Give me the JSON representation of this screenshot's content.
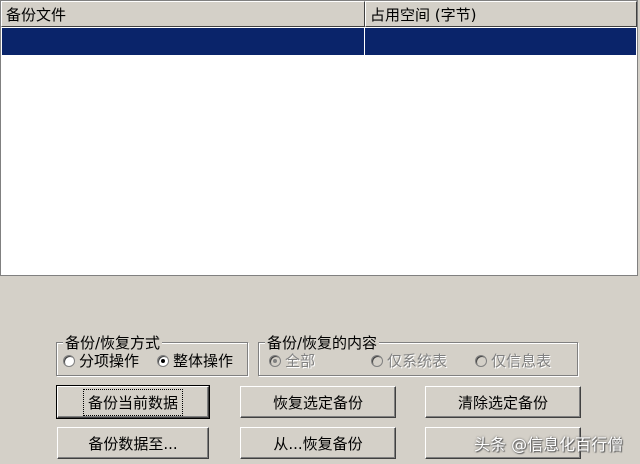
{
  "list": {
    "columns": [
      "备份文件",
      "占用空间 (字节)"
    ]
  },
  "mode_group": {
    "title": "备份/恢复方式",
    "options": [
      {
        "label": "分项操作",
        "selected": false
      },
      {
        "label": "整体操作",
        "selected": true
      }
    ]
  },
  "content_group": {
    "title": "备份/恢复的内容",
    "options": [
      {
        "label": "全部",
        "selected": true
      },
      {
        "label": "仅系统表",
        "selected": false
      },
      {
        "label": "仅信息表",
        "selected": false
      }
    ]
  },
  "buttons": {
    "backup_current": "备份当前数据",
    "restore_selected": "恢复选定备份",
    "clear_selected": "清除选定备份",
    "backup_to": "备份数据至...",
    "restore_from": "从...恢复备份",
    "blank": ""
  },
  "watermark": "头条 @信息化百行僧",
  "colors": {
    "selection": "#0a246a",
    "face": "#d4d0c8"
  }
}
